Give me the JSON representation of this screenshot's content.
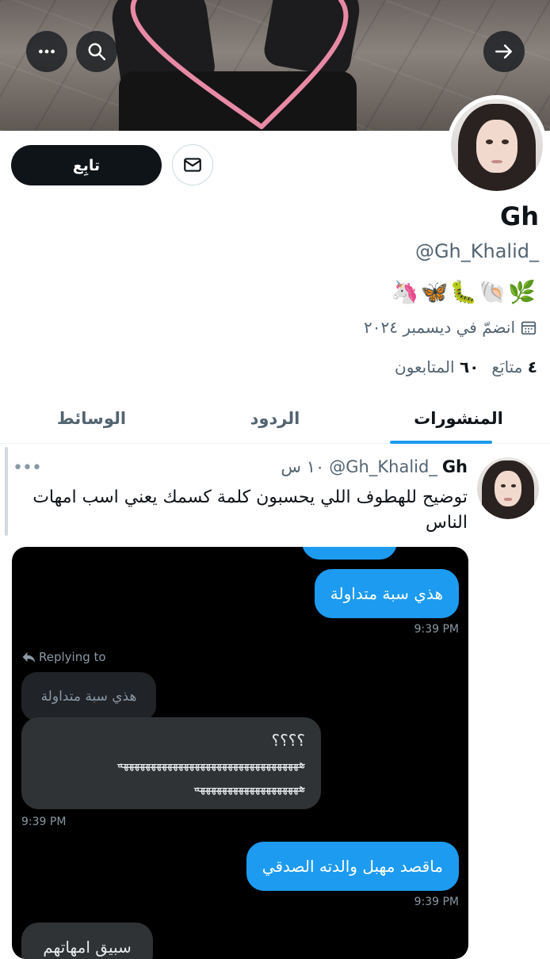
{
  "header": {
    "back_icon": "arrow-right-icon",
    "search_icon": "search-icon",
    "more_icon": "more-horizontal-icon"
  },
  "profile": {
    "follow_label": "تابِع",
    "message_icon": "envelope-icon",
    "name": "Gh",
    "handle": "@Gh_Khalid_",
    "bio_emojis": "🦄🦋🐛🐚🌿",
    "joined_icon": "calendar-icon",
    "joined": "انضمّ في ديسمبر ٢٠٢٤",
    "following_count": "٤",
    "following_label": "متابَع",
    "followers_count": "٦٠",
    "followers_label": "المتابعون"
  },
  "tabs": [
    {
      "label": "المنشورات",
      "active": true
    },
    {
      "label": "الردود",
      "active": false
    },
    {
      "label": "الوسائط",
      "active": false
    }
  ],
  "tweet": {
    "name": "Gh",
    "handle": "@Gh_Khalid_",
    "time": "١٠ س",
    "text": "توضيح للهطوف اللي يحسبون كلمة كسمك يعني اسب امهات الناس",
    "media": {
      "out_message_1": "هذي سبة متداولة",
      "time_1": "9:39 PM",
      "replying_label": "Replying to",
      "quoted_text": "هذي سبة متداولة",
      "in_message_line1": "؟؟؟؟",
      "in_message_line2": "هههههههههههههههههههههههههههههههههه",
      "in_message_line3": "هههههههههههههههههههه",
      "time_2": "9:39 PM",
      "out_message_2": "ماقصد مهبل والدته الصدقي",
      "time_3": "9:39 PM",
      "in_message_partial": "سبيق امهاتهم"
    }
  },
  "colors": {
    "accent": "#1d9bf0",
    "text": "#0f1419",
    "muted": "#536471"
  }
}
